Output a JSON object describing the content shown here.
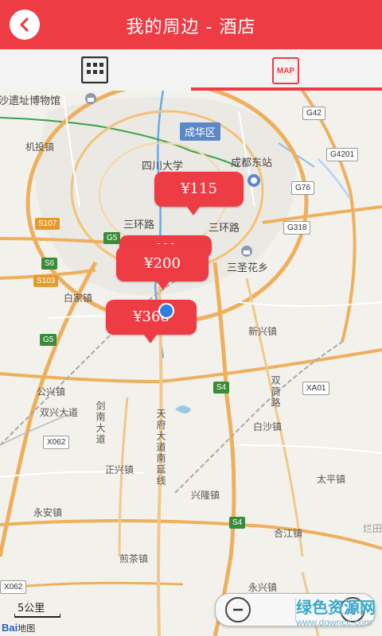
{
  "header": {
    "title": "我的周边 - 酒店",
    "back_icon": "chevron-left-icon"
  },
  "tabs": [
    {
      "icon": "grid-icon",
      "label": ""
    },
    {
      "icon": "map-icon",
      "label": "MAP",
      "active": true
    }
  ],
  "colors": {
    "accent": "#ee3c45",
    "location_dot": "#2f7fe0"
  },
  "map": {
    "district_tag": "成华区",
    "places": [
      {
        "name": "沙遗址博物馆"
      },
      {
        "name": "机投镇"
      },
      {
        "name": "四川大学"
      },
      {
        "name": "成都东站"
      },
      {
        "name": "三环路"
      },
      {
        "name": "三环路"
      },
      {
        "name": "三圣花乡"
      },
      {
        "name": "白家镇"
      },
      {
        "name": "新兴镇"
      },
      {
        "name": "公兴镇"
      },
      {
        "name": "双兴大道"
      },
      {
        "name": "剑南大道"
      },
      {
        "name": "天府大道南延线"
      },
      {
        "name": "双简路"
      },
      {
        "name": "白沙镇"
      },
      {
        "name": "正兴镇"
      },
      {
        "name": "太平镇"
      },
      {
        "name": "兴隆镇"
      },
      {
        "name": "永安镇"
      },
      {
        "name": "合江镇"
      },
      {
        "name": "煎茶镇"
      },
      {
        "name": "永兴镇"
      },
      {
        "name": "烂田"
      }
    ],
    "shields": [
      {
        "label": "G42"
      },
      {
        "label": "G4201"
      },
      {
        "label": "G76"
      },
      {
        "label": "G318"
      },
      {
        "label": "S107"
      },
      {
        "label": "G5"
      },
      {
        "label": "S6"
      },
      {
        "label": "S103"
      },
      {
        "label": "G5"
      },
      {
        "label": "S4"
      },
      {
        "label": "XA01"
      },
      {
        "label": "X062"
      },
      {
        "label": "S4"
      },
      {
        "label": "X062"
      }
    ],
    "price_markers": [
      {
        "price": "¥115"
      },
      {
        "price": "¥200"
      },
      {
        "price": "¥368"
      }
    ],
    "marker_partial_text": "- - -",
    "scale_label": "5公里",
    "baidu_logo": "Bai",
    "baidu_logo_suffix": "地图"
  },
  "zoom": {
    "zoom_out_icon": "zoom-out-icon",
    "zoom_in_icon": "zoom-in-icon"
  },
  "watermark": {
    "text": "绿色资源网",
    "url": "www.downcc.com"
  }
}
